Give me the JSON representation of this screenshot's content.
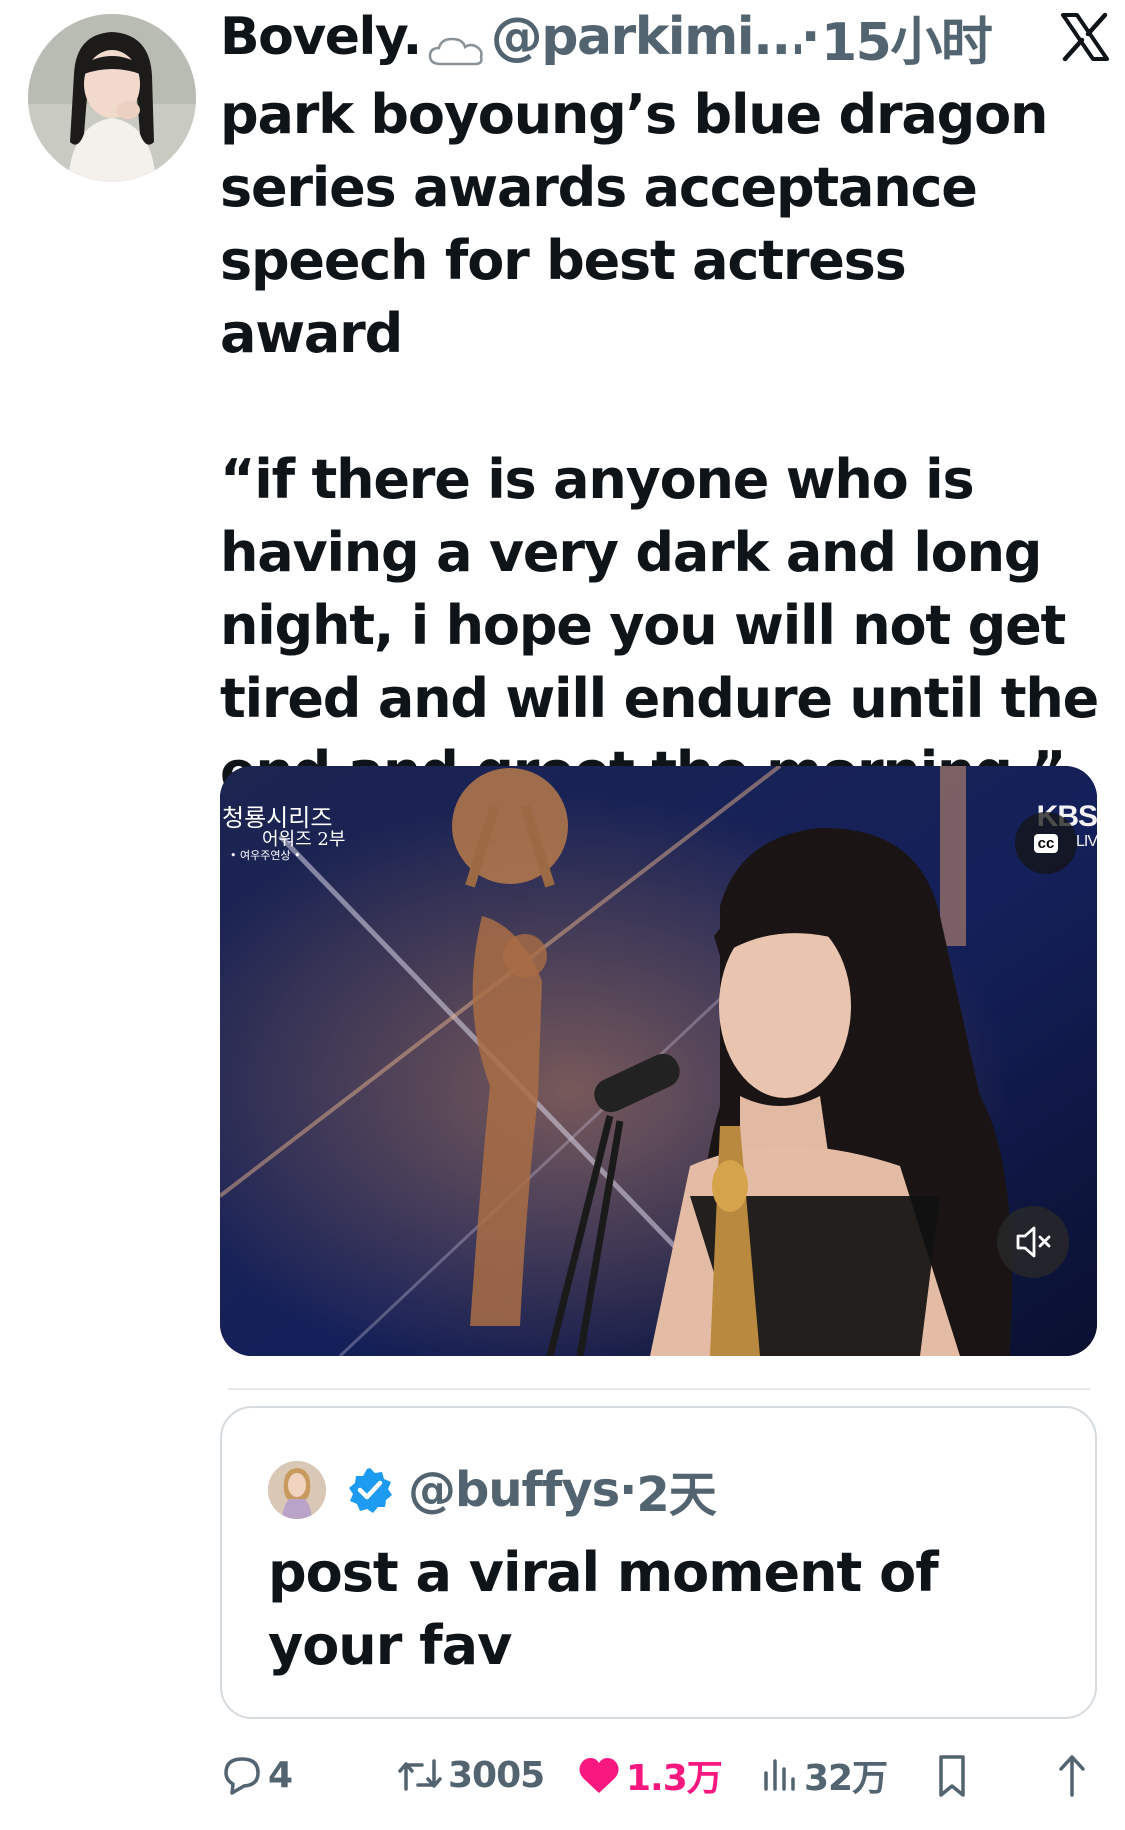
{
  "tweet": {
    "display_name": "Bovely.",
    "name_emoji_icon": "cloud-icon",
    "handle": "@parkimi...",
    "dot": "·",
    "time": "15小时",
    "text": "park boyoung’s blue dragon\nseries awards acceptance\nspeech for best actress award\n\n“if there is anyone who is\nhaving a very dark and long\nnight, i hope you will not get\ntired and will endure until the\nend and greet the morning.”"
  },
  "media": {
    "overlay_line1": "청룡시리즈",
    "overlay_line2": "어워즈 2부",
    "overlay_line3": "• 여우주연상 •",
    "broadcaster": "KBS",
    "broadcaster_sub": "LIV",
    "cc_label": "cc"
  },
  "quote": {
    "handle": "@buffys",
    "dot": "·",
    "time": "2天",
    "text": "post a viral moment of your fav"
  },
  "actions": {
    "replies": "4",
    "reposts": "3005",
    "likes": "1.3万",
    "views": "32万"
  },
  "colors": {
    "text": "#0f1419",
    "secondary": "#536471",
    "like": "#f91880",
    "verified": "#1d9bf0",
    "border": "#d6dbdf"
  }
}
